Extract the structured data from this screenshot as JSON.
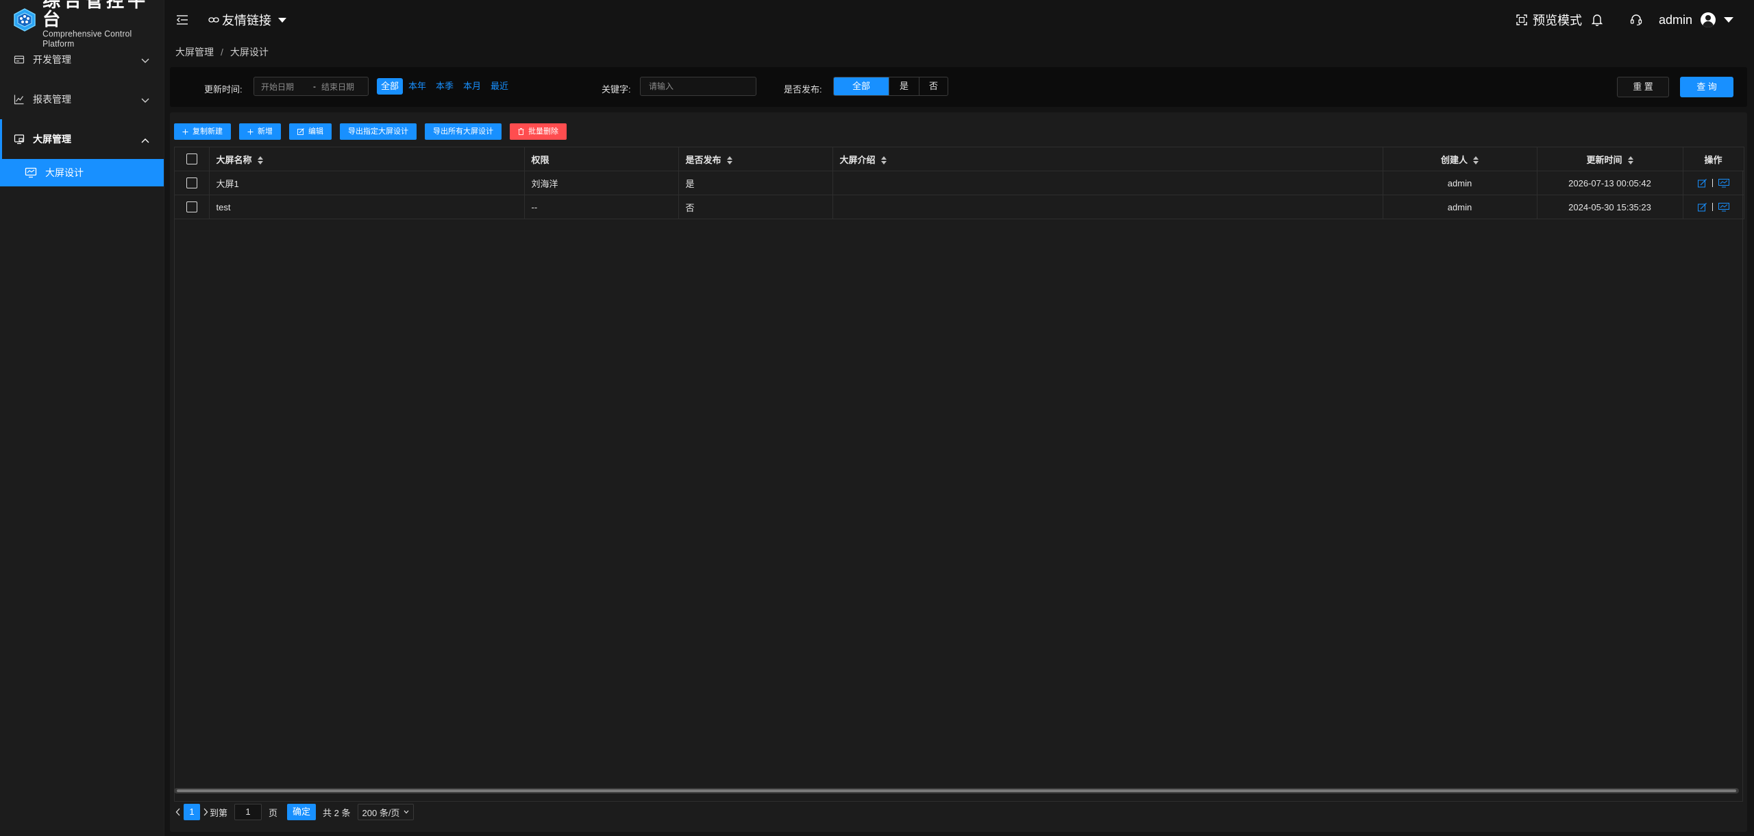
{
  "app": {
    "title": "综合管控平台",
    "subtitle": "Comprehensive Control Platform"
  },
  "sidebar": {
    "items": [
      {
        "label": "开发管理",
        "icon": "dev-icon",
        "expanded": false
      },
      {
        "label": "报表管理",
        "icon": "chart-icon",
        "expanded": false
      },
      {
        "label": "大屏管理",
        "icon": "screen-icon",
        "expanded": true
      }
    ],
    "sub_items": [
      {
        "label": "大屏设计",
        "icon": "monitor-icon",
        "active": true
      }
    ]
  },
  "header": {
    "friend_links": "友情链接",
    "preview_mode": "预览模式",
    "user": "admin"
  },
  "breadcrumb": [
    "大屏管理",
    "大屏设计"
  ],
  "filters": {
    "update_time_label": "更新时间:",
    "start_placeholder": "开始日期",
    "end_placeholder": "结束日期",
    "quick_ranges": [
      "全部",
      "本年",
      "本季",
      "本月",
      "最近"
    ],
    "quick_active": "全部",
    "keyword_label": "关键字:",
    "keyword_placeholder": "请输入",
    "published_label": "是否发布:",
    "published_options": [
      "全部",
      "是",
      "否"
    ],
    "published_active": "全部",
    "reset": "重 置",
    "query": "查 询"
  },
  "toolbar": {
    "copy_new": "复制新建",
    "add": "新增",
    "edit": "编辑",
    "export_selected": "导出指定大屏设计",
    "export_all": "导出所有大屏设计",
    "batch_delete": "批量删除"
  },
  "table": {
    "columns": {
      "name": "大屏名称",
      "permission": "权限",
      "published": "是否发布",
      "intro": "大屏介绍",
      "creator": "创建人",
      "updated": "更新时间",
      "ops": "操作"
    },
    "rows": [
      {
        "name": "大屏1",
        "permission": "刘海洋",
        "published": "是",
        "intro": "",
        "creator": "admin",
        "updated": "2026-07-13 00:05:42"
      },
      {
        "name": "test",
        "permission": "--",
        "published": "否",
        "intro": "",
        "creator": "admin",
        "updated": "2024-05-30 15:35:23"
      }
    ]
  },
  "pagination": {
    "current": "1",
    "goto_label": "到第",
    "goto_value": "1",
    "page_label": "页",
    "confirm": "确定",
    "total": "共 2 条",
    "page_size": "200 条/页"
  },
  "colors": {
    "accent": "#1890ff",
    "danger": "#ff4d4f",
    "background": "#141414",
    "panel": "#1c1c1c"
  }
}
